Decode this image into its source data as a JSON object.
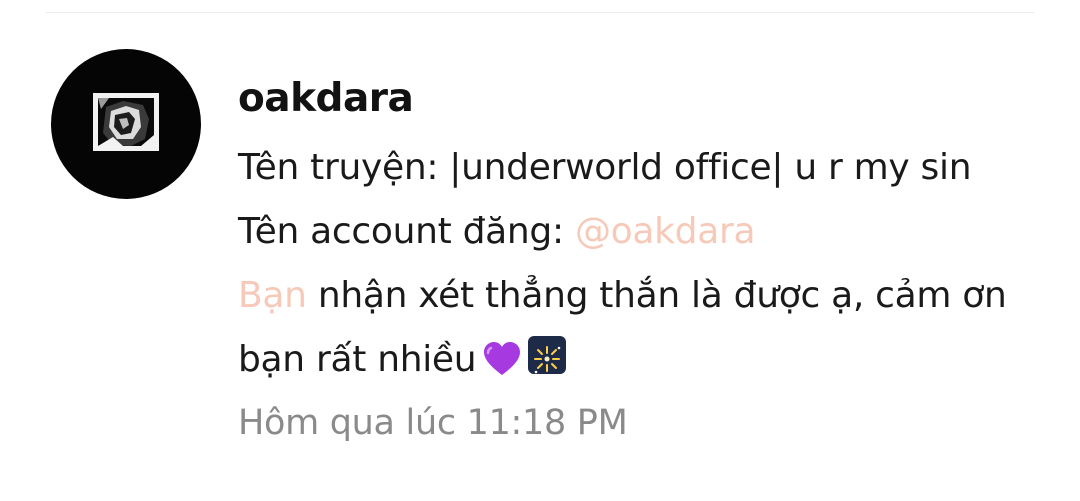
{
  "comment": {
    "username": "oakdara",
    "line1": "Tên truyện: |underworld office| u r my sin",
    "line2_prefix": "Tên account đăng: ",
    "line2_mention": "@oakdara",
    "line3_mention": "Bạn",
    "line3_rest": " nhận xét thẳng thắn là được ạ, cảm ơn",
    "line4_text": "bạn rất nhiều",
    "emojis": [
      "purple-heart-icon",
      "fireworks-icon"
    ],
    "timestamp": "Hôm qua lúc 11:18 PM"
  },
  "colors": {
    "mention": "#f6c9b8",
    "timestamp": "#8a8a8a",
    "text": "#1a1a1a",
    "avatar_bg": "#050505"
  }
}
